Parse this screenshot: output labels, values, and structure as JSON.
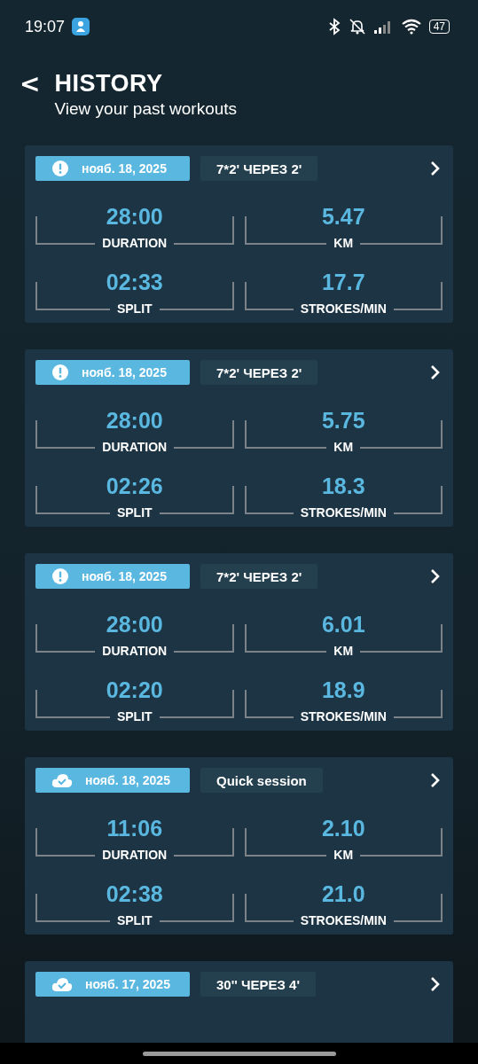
{
  "status_bar": {
    "time": "19:07",
    "battery": "47"
  },
  "header": {
    "back": "<",
    "title": "HISTORY",
    "subtitle": "View your past workouts"
  },
  "workouts": [
    {
      "kind": "warning",
      "date": "нояб. 18, 2025",
      "name": "7*2' ЧЕРЕЗ 2'",
      "stats": [
        {
          "value": "28:00",
          "label": "DURATION"
        },
        {
          "value": "5.47",
          "label": "KM"
        },
        {
          "value": "02:33",
          "label": "SPLIT"
        },
        {
          "value": "17.7",
          "label": "STROKES/MIN"
        }
      ]
    },
    {
      "kind": "warning",
      "date": "нояб. 18, 2025",
      "name": "7*2' ЧЕРЕЗ 2'",
      "stats": [
        {
          "value": "28:00",
          "label": "DURATION"
        },
        {
          "value": "5.75",
          "label": "KM"
        },
        {
          "value": "02:26",
          "label": "SPLIT"
        },
        {
          "value": "18.3",
          "label": "STROKES/MIN"
        }
      ]
    },
    {
      "kind": "warning",
      "date": "нояб. 18, 2025",
      "name": "7*2' ЧЕРЕЗ 2'",
      "stats": [
        {
          "value": "28:00",
          "label": "DURATION"
        },
        {
          "value": "6.01",
          "label": "KM"
        },
        {
          "value": "02:20",
          "label": "SPLIT"
        },
        {
          "value": "18.9",
          "label": "STROKES/MIN"
        }
      ]
    },
    {
      "kind": "synced",
      "date": "нояб. 18, 2025",
      "name": "Quick session",
      "stats": [
        {
          "value": "11:06",
          "label": "DURATION"
        },
        {
          "value": "2.10",
          "label": "KM"
        },
        {
          "value": "02:38",
          "label": "SPLIT"
        },
        {
          "value": "21.0",
          "label": "STROKES/MIN"
        }
      ]
    },
    {
      "kind": "synced",
      "date": "нояб. 17, 2025",
      "name": "30'' ЧЕРЕЗ 4'"
    }
  ]
}
